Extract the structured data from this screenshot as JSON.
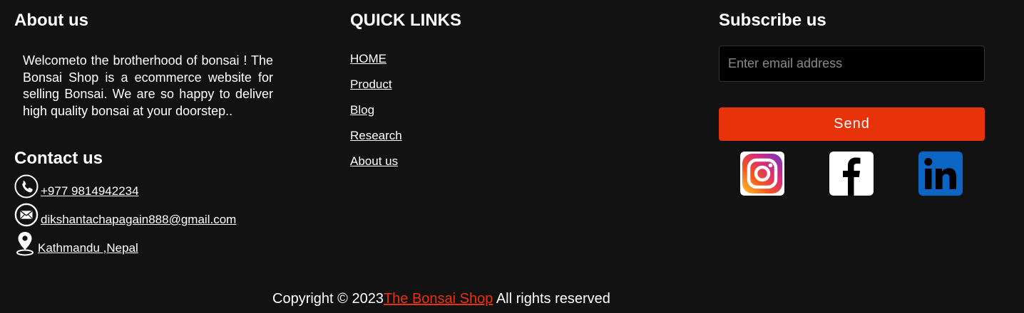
{
  "about": {
    "title": "About us",
    "text": "Welcometo the brotherhood of bonsai ! The Bonsai Shop is a ecommerce website for selling Bonsai. We are so happy to deliver high quality bonsai at your doorstep.."
  },
  "contact": {
    "title": "Contact us",
    "phone": "+977 9814942234",
    "email": "dikshantachapagain888@gmail.com",
    "location": "Kathmandu ,Nepal"
  },
  "quick_links": {
    "title": "QUICK LINKS",
    "items": [
      "HOME",
      "Product",
      "Blog",
      "Research",
      "About us"
    ]
  },
  "subscribe": {
    "title": "Subscribe us",
    "email_placeholder": "Enter email address",
    "email_value": "",
    "send_label": "Send",
    "socials": [
      "instagram-icon",
      "facebook-icon",
      "linkedin-icon"
    ]
  },
  "footer": {
    "copyright_prefix": "Copyright © 2023",
    "brand": "The Bonsai Shop",
    "copyright_suffix": " All rights reserved"
  },
  "colors": {
    "background": "#121212",
    "accent": "#e8320a",
    "linkedin": "#0a66c2"
  }
}
